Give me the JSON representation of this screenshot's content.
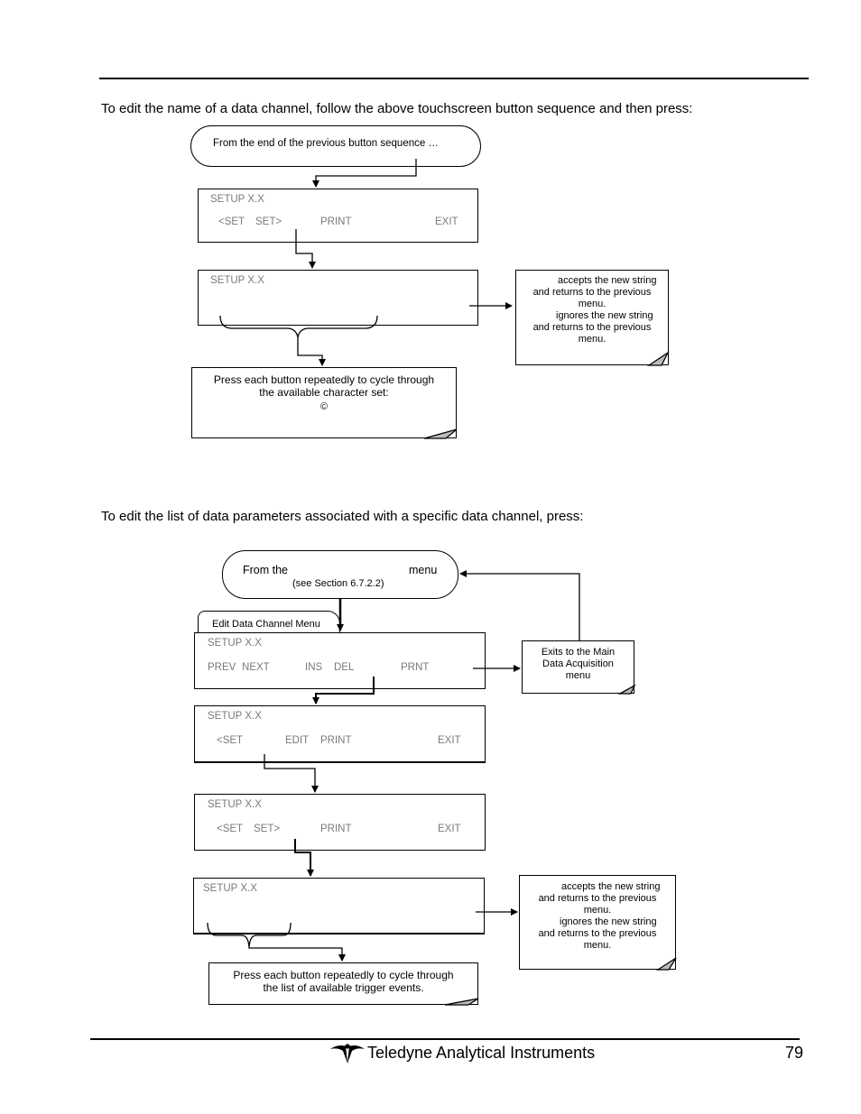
{
  "page": {
    "footer": {
      "company": "Teledyne Analytical Instruments",
      "page_number": "79",
      "logo_icon": "teledyne-logo-icon"
    }
  },
  "section1": {
    "intro": "To edit the name of a data channel, follow the above touchscreen button sequence and then press:",
    "start_box": "From the end of the previous button sequence …",
    "screen1": {
      "title": "SETUP X.X",
      "buttons": [
        "<SET",
        "SET>",
        "PRINT",
        "EXIT"
      ]
    },
    "screen2": {
      "title": "SETUP X.X"
    },
    "side_note": {
      "line1": "accepts the new string",
      "line2": "and returns to the previous",
      "line3": "menu.",
      "line4": "ignores the new string",
      "line5": "and returns to the previous",
      "line6": "menu."
    },
    "bottom_note": {
      "line1": "Press each button repeatedly to cycle through",
      "line2": "the available character set:",
      "symbol": "©"
    }
  },
  "section2": {
    "intro": "To edit the list of data parameters associated with a specific data channel, press:",
    "start_box": {
      "prefix": "From the",
      "suffix": "menu",
      "sub": "(see Section 6.7.2.2)"
    },
    "tab_label": "Edit Data Channel Menu",
    "screen1": {
      "title": "SETUP X.X",
      "buttons": [
        "PREV",
        "NEXT",
        "INS",
        "DEL",
        "PRNT"
      ]
    },
    "exit_note": {
      "line1": "Exits to the Main",
      "line2": "Data Acquisition",
      "line3": "menu"
    },
    "screen2": {
      "title": "SETUP X.X",
      "buttons": [
        "<SET",
        "EDIT",
        "PRINT",
        "EXIT"
      ]
    },
    "screen3": {
      "title": "SETUP X.X",
      "buttons": [
        "<SET",
        "SET>",
        "PRINT",
        "EXIT"
      ]
    },
    "screen4": {
      "title": "SETUP X.X"
    },
    "side_note": {
      "line1": "accepts the new string",
      "line2": "and returns to the previous",
      "line3": "menu.",
      "line4": "ignores the new string",
      "line5": "and returns to the previous",
      "line6": "menu."
    },
    "bottom_note": {
      "line1": "Press each button repeatedly to cycle through",
      "line2": "the list of available trigger events."
    }
  }
}
